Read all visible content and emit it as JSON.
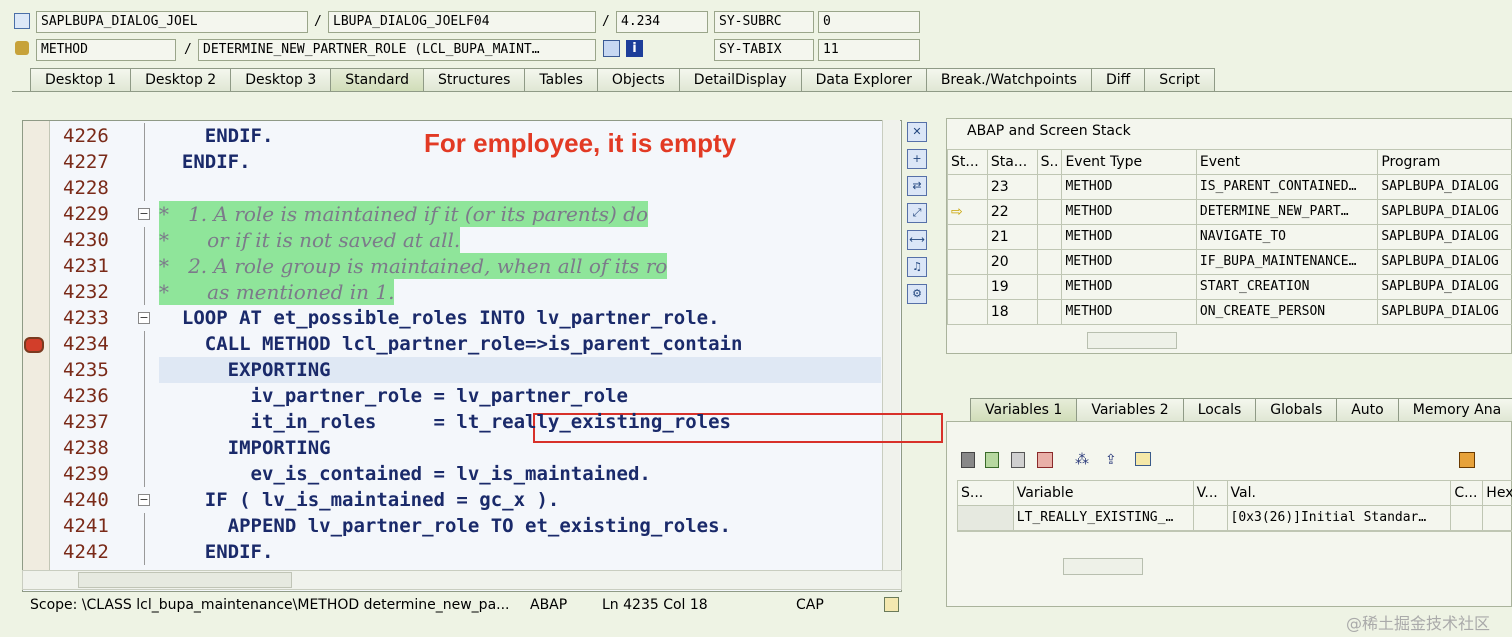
{
  "header": {
    "program": "SAPLBUPA_DIALOG_JOEL",
    "include": "LBUPA_DIALOG_JOELF04",
    "line": "4.234",
    "sy_subrc_label": "SY-SUBRC",
    "sy_subrc_value": "0",
    "type": "METHOD",
    "method": "DETERMINE_NEW_PARTNER_ROLE (LCL_BUPA_MAINT…",
    "sy_tabix_label": "SY-TABIX",
    "sy_tabix_value": "11"
  },
  "tabs": [
    "Desktop 1",
    "Desktop 2",
    "Desktop 3",
    "Standard",
    "Structures",
    "Tables",
    "Objects",
    "DetailDisplay",
    "Data Explorer",
    "Break./Watchpoints",
    "Diff",
    "Script"
  ],
  "active_tab": "Standard",
  "editor": {
    "lines": [
      {
        "n": "4226",
        "text": "    ENDIF."
      },
      {
        "n": "4227",
        "text": "  ENDIF."
      },
      {
        "n": "4228",
        "text": ""
      },
      {
        "n": "4229",
        "text": "*   1. A role is maintained if it (or its parents) do"
      },
      {
        "n": "4230",
        "text": "*      or if it is not saved at all."
      },
      {
        "n": "4231",
        "text": "*   2. A role group is maintained, when all of its ro"
      },
      {
        "n": "4232",
        "text": "*      as mentioned in 1."
      },
      {
        "n": "4233",
        "text": "  LOOP AT et_possible_roles INTO lv_partner_role."
      },
      {
        "n": "4234",
        "text": "    CALL METHOD lcl_partner_role=>is_parent_contain"
      },
      {
        "n": "4235",
        "text": "      EXPORTING"
      },
      {
        "n": "4236",
        "text": "        iv_partner_role = lv_partner_role"
      },
      {
        "n": "4237",
        "text": "        it_in_roles     = lt_really_existing_roles"
      },
      {
        "n": "4238",
        "text": "      IMPORTING"
      },
      {
        "n": "4239",
        "text": "        ev_is_contained = lv_is_maintained."
      },
      {
        "n": "4240",
        "text": "    IF ( lv_is_maintained = gc_x )."
      },
      {
        "n": "4241",
        "text": "      APPEND lv_partner_role TO et_existing_roles."
      },
      {
        "n": "4242",
        "text": "    ENDIF."
      }
    ],
    "annotation": "For employee, it is empty"
  },
  "status": {
    "scope": "Scope: \\CLASS lcl_bupa_maintenance\\METHOD determine_new_pa...",
    "lang": "ABAP",
    "pos": "Ln 4235 Col  18",
    "cap": "CAP"
  },
  "stack": {
    "title": "ABAP and Screen Stack",
    "headers": [
      "St...",
      "Sta...",
      "S..",
      "Event Type",
      "Event",
      "Program"
    ],
    "rows": [
      {
        "cur": "",
        "level": "23",
        "type": "METHOD",
        "event": "IS_PARENT_CONTAINED…",
        "program": "SAPLBUPA_DIALOG"
      },
      {
        "cur": "⇨",
        "level": "22",
        "type": "METHOD",
        "event": "DETERMINE_NEW_PART…",
        "program": "SAPLBUPA_DIALOG"
      },
      {
        "cur": "",
        "level": "21",
        "type": "METHOD",
        "event": "NAVIGATE_TO",
        "program": "SAPLBUPA_DIALOG"
      },
      {
        "cur": "",
        "level": "20",
        "type": "METHOD",
        "event": "IF_BUPA_MAINTENANCE…",
        "program": "SAPLBUPA_DIALOG"
      },
      {
        "cur": "",
        "level": "19",
        "type": "METHOD",
        "event": "START_CREATION",
        "program": "SAPLBUPA_DIALOG"
      },
      {
        "cur": "",
        "level": "18",
        "type": "METHOD",
        "event": "ON_CREATE_PERSON",
        "program": "SAPLBUPA_DIALOG"
      }
    ]
  },
  "vars": {
    "tabs": [
      "Variables 1",
      "Variables 2",
      "Locals",
      "Globals",
      "Auto",
      "Memory Ana"
    ],
    "headers": [
      "S...",
      "Variable",
      "V...",
      "Val.",
      "C...",
      "Hex"
    ],
    "rows": [
      {
        "variable": "LT_REALLY_EXISTING_…",
        "value": "[0x3(26)]Initial Standar…"
      }
    ]
  },
  "watermark": "@稀土掘金技术社区"
}
